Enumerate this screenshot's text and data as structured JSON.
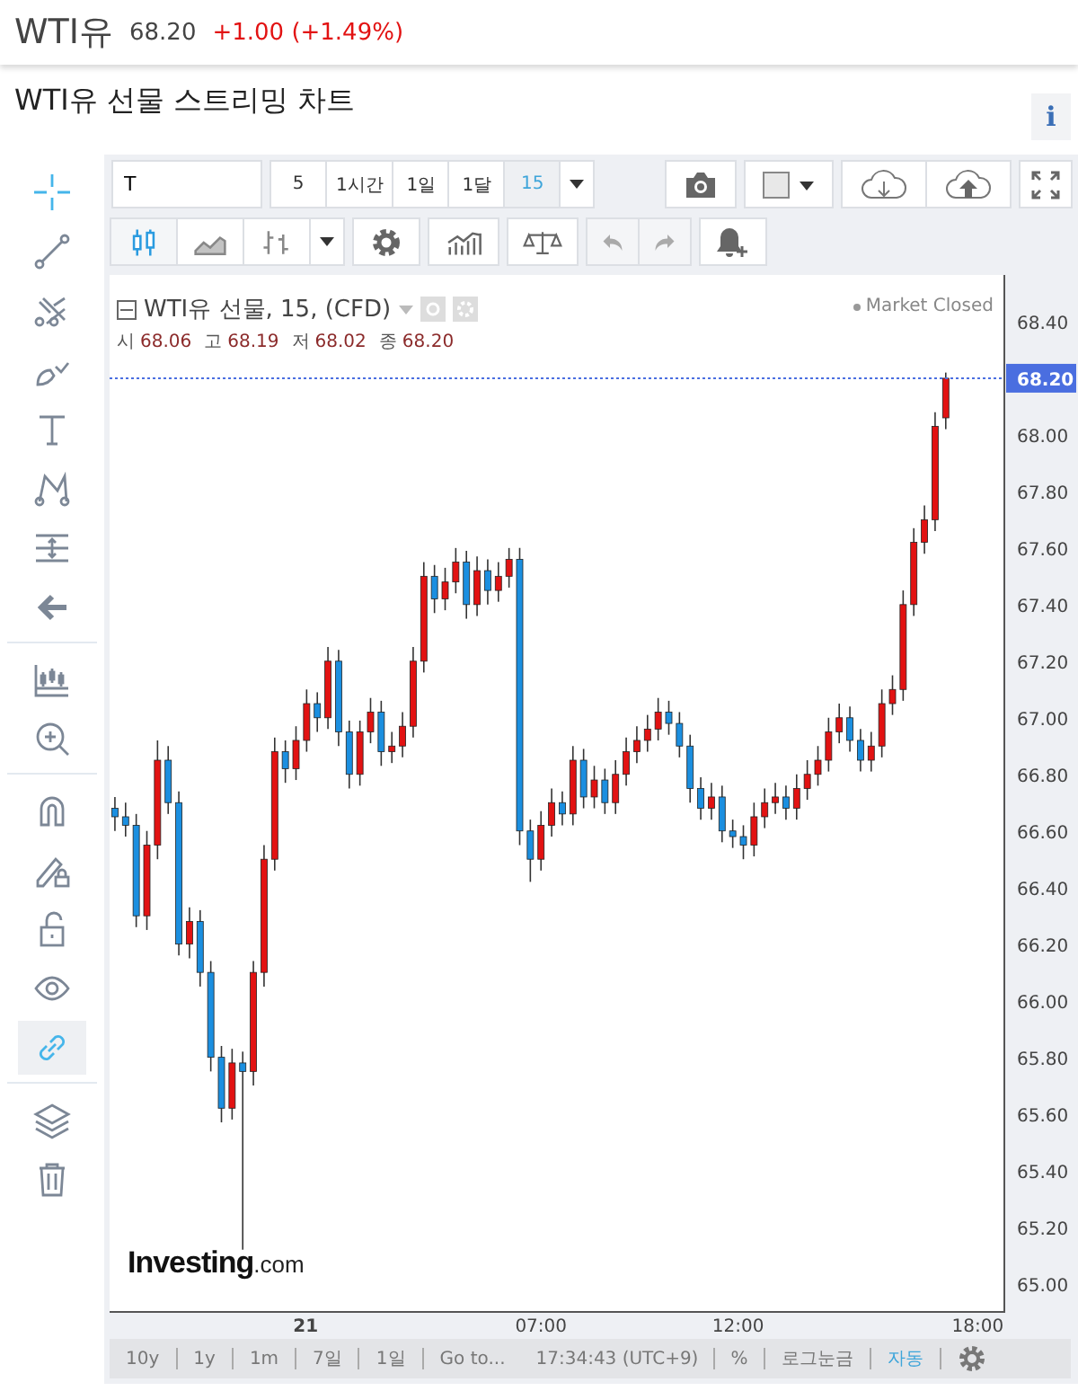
{
  "header": {
    "symbol": "WTI유",
    "price": "68.20",
    "change": "+1.00 (+1.49%)"
  },
  "page_title": "WTI유 선물 스트리밍 차트",
  "info_button": "i",
  "drawing_tools": [
    {
      "tools": [
        {
          "kind": "crosshair",
          "selected": true
        },
        {
          "kind": "line",
          "selected": false
        },
        {
          "kind": "pitchfork",
          "selected": false
        },
        {
          "kind": "brush",
          "selected": false
        },
        {
          "kind": "text",
          "selected": false
        },
        {
          "kind": "pattern",
          "selected": false
        },
        {
          "kind": "measure",
          "selected": false
        },
        {
          "kind": "back",
          "selected": false
        }
      ]
    },
    {
      "tools": [
        {
          "kind": "bars-measure",
          "selected": false
        },
        {
          "kind": "zoom",
          "selected": false
        }
      ]
    },
    {
      "tools": [
        {
          "kind": "magnet",
          "selected": false
        },
        {
          "kind": "pencil-lock",
          "selected": false
        },
        {
          "kind": "lock",
          "selected": false
        },
        {
          "kind": "eye",
          "selected": false
        },
        {
          "kind": "link",
          "selected": true
        }
      ]
    },
    {
      "tools": [
        {
          "kind": "layers",
          "selected": false
        },
        {
          "kind": "trash",
          "selected": false
        }
      ]
    }
  ],
  "symbol_field": {
    "value": "T"
  },
  "intervals": [
    {
      "label": "5",
      "selected": false
    },
    {
      "label": "1시간",
      "selected": false
    },
    {
      "label": "1일",
      "selected": false
    },
    {
      "label": "1달",
      "selected": false
    },
    {
      "label": "15",
      "selected": true
    }
  ],
  "chart_types": [
    {
      "kind": "candles",
      "selected": true
    },
    {
      "kind": "area",
      "selected": false
    },
    {
      "kind": "bars",
      "selected": false
    }
  ],
  "legend": {
    "title": "WTI유 선물, 15, (CFD)",
    "ohlc": [
      {
        "label": "시",
        "value": "68.06"
      },
      {
        "label": "고",
        "value": "68.19"
      },
      {
        "label": "저",
        "value": "68.02"
      },
      {
        "label": "종",
        "value": "68.20"
      }
    ],
    "market_status": "Market Closed"
  },
  "chart": {
    "logo": {
      "name": "Investing",
      "suffix": ".com"
    },
    "x_labels": [
      {
        "label": "21",
        "kind": "day"
      },
      {
        "label": "07:00",
        "kind": "time"
      },
      {
        "label": "12:00",
        "kind": "time"
      },
      {
        "label": "18:00",
        "kind": "time"
      }
    ],
    "chart_data": {
      "type": "candlestick",
      "ylim": [
        64.9,
        68.565
      ],
      "ref_lines": [
        {
          "axis": "y",
          "value": 68.2,
          "label": "68.20"
        }
      ],
      "yticks": [
        {
          "value": 68.4,
          "label": "68.40"
        },
        {
          "value": 68.0,
          "label": "68.00"
        },
        {
          "value": 67.8,
          "label": "67.80"
        },
        {
          "value": 67.6,
          "label": "67.60"
        },
        {
          "value": 67.4,
          "label": "67.40"
        },
        {
          "value": 67.2,
          "label": "67.20"
        },
        {
          "value": 67.0,
          "label": "67.00"
        },
        {
          "value": 66.8,
          "label": "66.80"
        },
        {
          "value": 66.6,
          "label": "66.60"
        },
        {
          "value": 66.4,
          "label": "66.40"
        },
        {
          "value": 66.2,
          "label": "66.20"
        },
        {
          "value": 66.0,
          "label": "66.00"
        },
        {
          "value": 65.8,
          "label": "65.80"
        },
        {
          "value": 65.6,
          "label": "65.60"
        },
        {
          "value": 65.4,
          "label": "65.40"
        },
        {
          "value": 65.2,
          "label": "65.20"
        },
        {
          "value": 65.0,
          "label": "65.00"
        }
      ],
      "ohlc": [
        [
          66.68,
          66.72,
          66.6,
          66.65
        ],
        [
          66.65,
          66.7,
          66.58,
          66.62
        ],
        [
          66.62,
          66.66,
          66.26,
          66.3
        ],
        [
          66.3,
          66.6,
          66.25,
          66.55
        ],
        [
          66.55,
          66.92,
          66.5,
          66.85
        ],
        [
          66.85,
          66.9,
          66.66,
          66.7
        ],
        [
          66.7,
          66.74,
          66.16,
          66.2
        ],
        [
          66.2,
          66.33,
          66.15,
          66.28
        ],
        [
          66.28,
          66.32,
          66.05,
          66.1
        ],
        [
          66.1,
          66.14,
          65.75,
          65.8
        ],
        [
          65.8,
          65.84,
          65.57,
          65.62
        ],
        [
          65.62,
          65.83,
          65.58,
          65.78
        ],
        [
          65.78,
          65.82,
          65.12,
          65.75
        ],
        [
          65.75,
          66.14,
          65.7,
          66.1
        ],
        [
          66.1,
          66.55,
          66.05,
          66.5
        ],
        [
          66.5,
          66.93,
          66.46,
          66.88
        ],
        [
          66.88,
          66.92,
          66.77,
          66.82
        ],
        [
          66.82,
          66.97,
          66.78,
          66.92
        ],
        [
          66.92,
          67.1,
          66.88,
          67.05
        ],
        [
          67.05,
          67.09,
          66.95,
          67.0
        ],
        [
          67.0,
          67.25,
          66.96,
          67.2
        ],
        [
          67.2,
          67.24,
          66.9,
          66.95
        ],
        [
          66.95,
          66.99,
          66.75,
          66.8
        ],
        [
          66.8,
          66.99,
          66.76,
          66.95
        ],
        [
          66.95,
          67.07,
          66.91,
          67.02
        ],
        [
          67.02,
          67.06,
          66.83,
          66.88
        ],
        [
          66.88,
          66.95,
          66.84,
          66.9
        ],
        [
          66.9,
          67.02,
          66.86,
          66.97
        ],
        [
          66.97,
          67.25,
          66.93,
          67.2
        ],
        [
          67.2,
          67.55,
          67.16,
          67.5
        ],
        [
          67.5,
          67.54,
          67.37,
          67.42
        ],
        [
          67.42,
          67.53,
          67.38,
          67.48
        ],
        [
          67.48,
          67.6,
          67.44,
          67.55
        ],
        [
          67.55,
          67.59,
          67.35,
          67.4
        ],
        [
          67.4,
          67.57,
          67.36,
          67.52
        ],
        [
          67.52,
          67.56,
          67.4,
          67.45
        ],
        [
          67.45,
          67.55,
          67.41,
          67.5
        ],
        [
          67.5,
          67.6,
          67.46,
          67.56
        ],
        [
          67.56,
          67.6,
          66.55,
          66.6
        ],
        [
          66.6,
          66.64,
          66.42,
          66.5
        ],
        [
          66.5,
          66.67,
          66.46,
          66.62
        ],
        [
          66.62,
          66.75,
          66.58,
          66.7
        ],
        [
          66.7,
          66.74,
          66.62,
          66.66
        ],
        [
          66.66,
          66.9,
          66.62,
          66.85
        ],
        [
          66.85,
          66.89,
          66.68,
          66.72
        ],
        [
          66.72,
          66.83,
          66.68,
          66.78
        ],
        [
          66.78,
          66.82,
          66.66,
          66.7
        ],
        [
          66.7,
          66.85,
          66.66,
          66.8
        ],
        [
          66.8,
          66.93,
          66.76,
          66.88
        ],
        [
          66.88,
          66.97,
          66.84,
          66.92
        ],
        [
          66.92,
          67.01,
          66.88,
          66.96
        ],
        [
          66.96,
          67.07,
          66.92,
          67.02
        ],
        [
          67.02,
          67.06,
          66.94,
          66.98
        ],
        [
          66.98,
          67.02,
          66.86,
          66.9
        ],
        [
          66.9,
          66.94,
          66.7,
          66.75
        ],
        [
          66.75,
          66.79,
          66.64,
          66.68
        ],
        [
          66.68,
          66.77,
          66.64,
          66.72
        ],
        [
          66.72,
          66.76,
          66.56,
          66.6
        ],
        [
          66.6,
          66.64,
          66.54,
          66.58
        ],
        [
          66.58,
          66.62,
          66.5,
          66.55
        ],
        [
          66.55,
          66.7,
          66.51,
          66.65
        ],
        [
          66.65,
          66.75,
          66.61,
          66.7
        ],
        [
          66.7,
          66.77,
          66.66,
          66.72
        ],
        [
          66.72,
          66.76,
          66.64,
          66.68
        ],
        [
          66.68,
          66.8,
          66.64,
          66.75
        ],
        [
          66.75,
          66.85,
          66.71,
          66.8
        ],
        [
          66.8,
          66.9,
          66.76,
          66.85
        ],
        [
          66.85,
          67.0,
          66.81,
          66.95
        ],
        [
          66.95,
          67.05,
          66.91,
          67.0
        ],
        [
          67.0,
          67.04,
          66.88,
          66.92
        ],
        [
          66.92,
          66.96,
          66.81,
          66.85
        ],
        [
          66.85,
          66.95,
          66.81,
          66.9
        ],
        [
          66.9,
          67.1,
          66.86,
          67.05
        ],
        [
          67.05,
          67.15,
          67.01,
          67.1
        ],
        [
          67.1,
          67.45,
          67.06,
          67.4
        ],
        [
          67.4,
          67.67,
          67.36,
          67.62
        ],
        [
          67.62,
          67.75,
          67.58,
          67.7
        ],
        [
          67.7,
          68.08,
          67.66,
          68.03
        ],
        [
          68.06,
          68.22,
          68.02,
          68.2
        ]
      ]
    }
  },
  "bottom_bar": {
    "ranges": [
      "10y",
      "1y",
      "1m",
      "7일",
      "1일"
    ],
    "goto": "Go to...",
    "clock": "17:34:43 (UTC+9)",
    "options": [
      {
        "label": "%",
        "selected": false
      },
      {
        "label": "로그눈금",
        "selected": false
      },
      {
        "label": "자동",
        "selected": true
      }
    ]
  }
}
